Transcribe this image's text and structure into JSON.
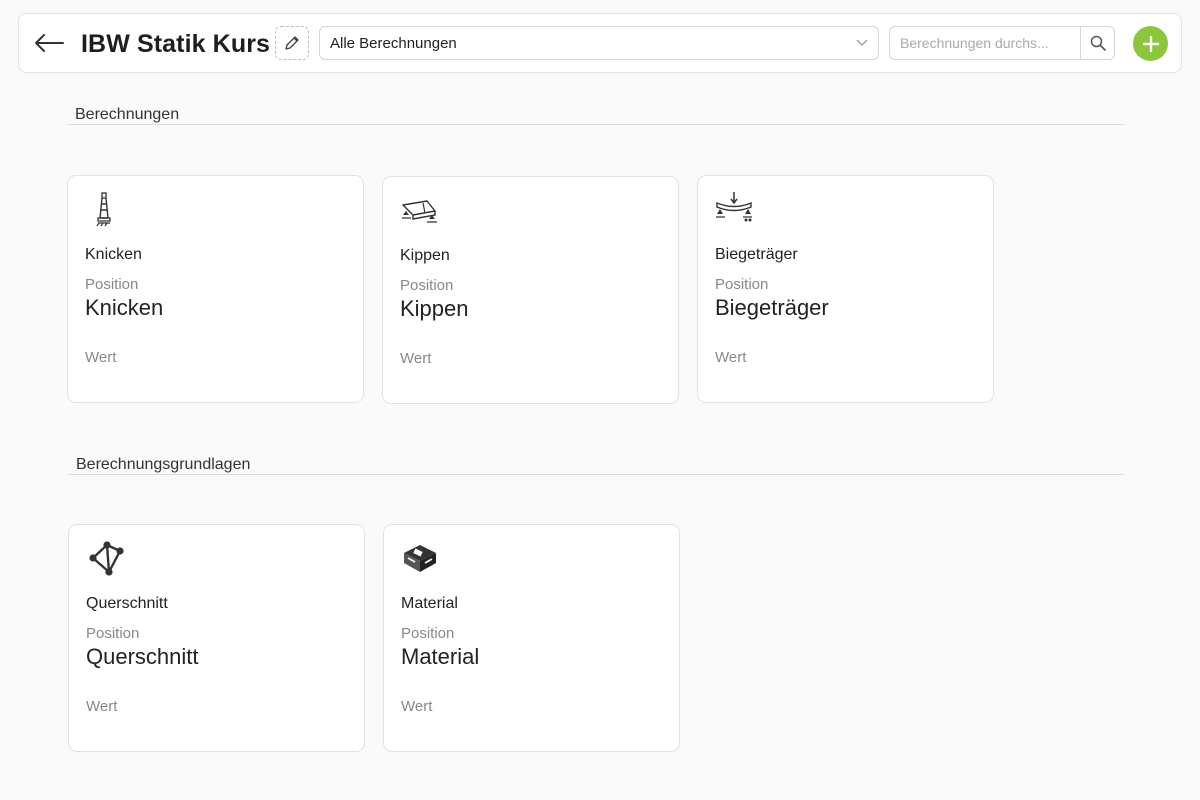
{
  "header": {
    "title": "IBW Statik Kurs",
    "filter": {
      "selected": "Alle Berechnungen"
    },
    "search": {
      "placeholder": "Berechnungen durchs..."
    }
  },
  "sections": [
    {
      "title": "Berechnungen",
      "cards": [
        {
          "title": "Knicken",
          "position_label": "Position",
          "position_value": "Knicken",
          "value_label": "Wert",
          "icon": "column-buckling-icon"
        },
        {
          "title": "Kippen",
          "position_label": "Position",
          "position_value": "Kippen",
          "value_label": "Wert",
          "icon": "beam-tilting-icon"
        },
        {
          "title": "Biegeträger",
          "position_label": "Position",
          "position_value": "Biegeträger",
          "value_label": "Wert",
          "icon": "bending-beam-icon"
        }
      ]
    },
    {
      "title": "Berechnungsgrundlagen",
      "cards": [
        {
          "title": "Querschnitt",
          "position_label": "Position",
          "position_value": "Querschnitt",
          "value_label": "Wert",
          "icon": "cross-section-icon"
        },
        {
          "title": "Material",
          "position_label": "Position",
          "position_value": "Material",
          "value_label": "Wert",
          "icon": "material-icon"
        }
      ]
    }
  ],
  "colors": {
    "accent": "#8cc63f",
    "background": "#fafafa",
    "card": "#ffffff",
    "border": "#e2e2e2"
  }
}
